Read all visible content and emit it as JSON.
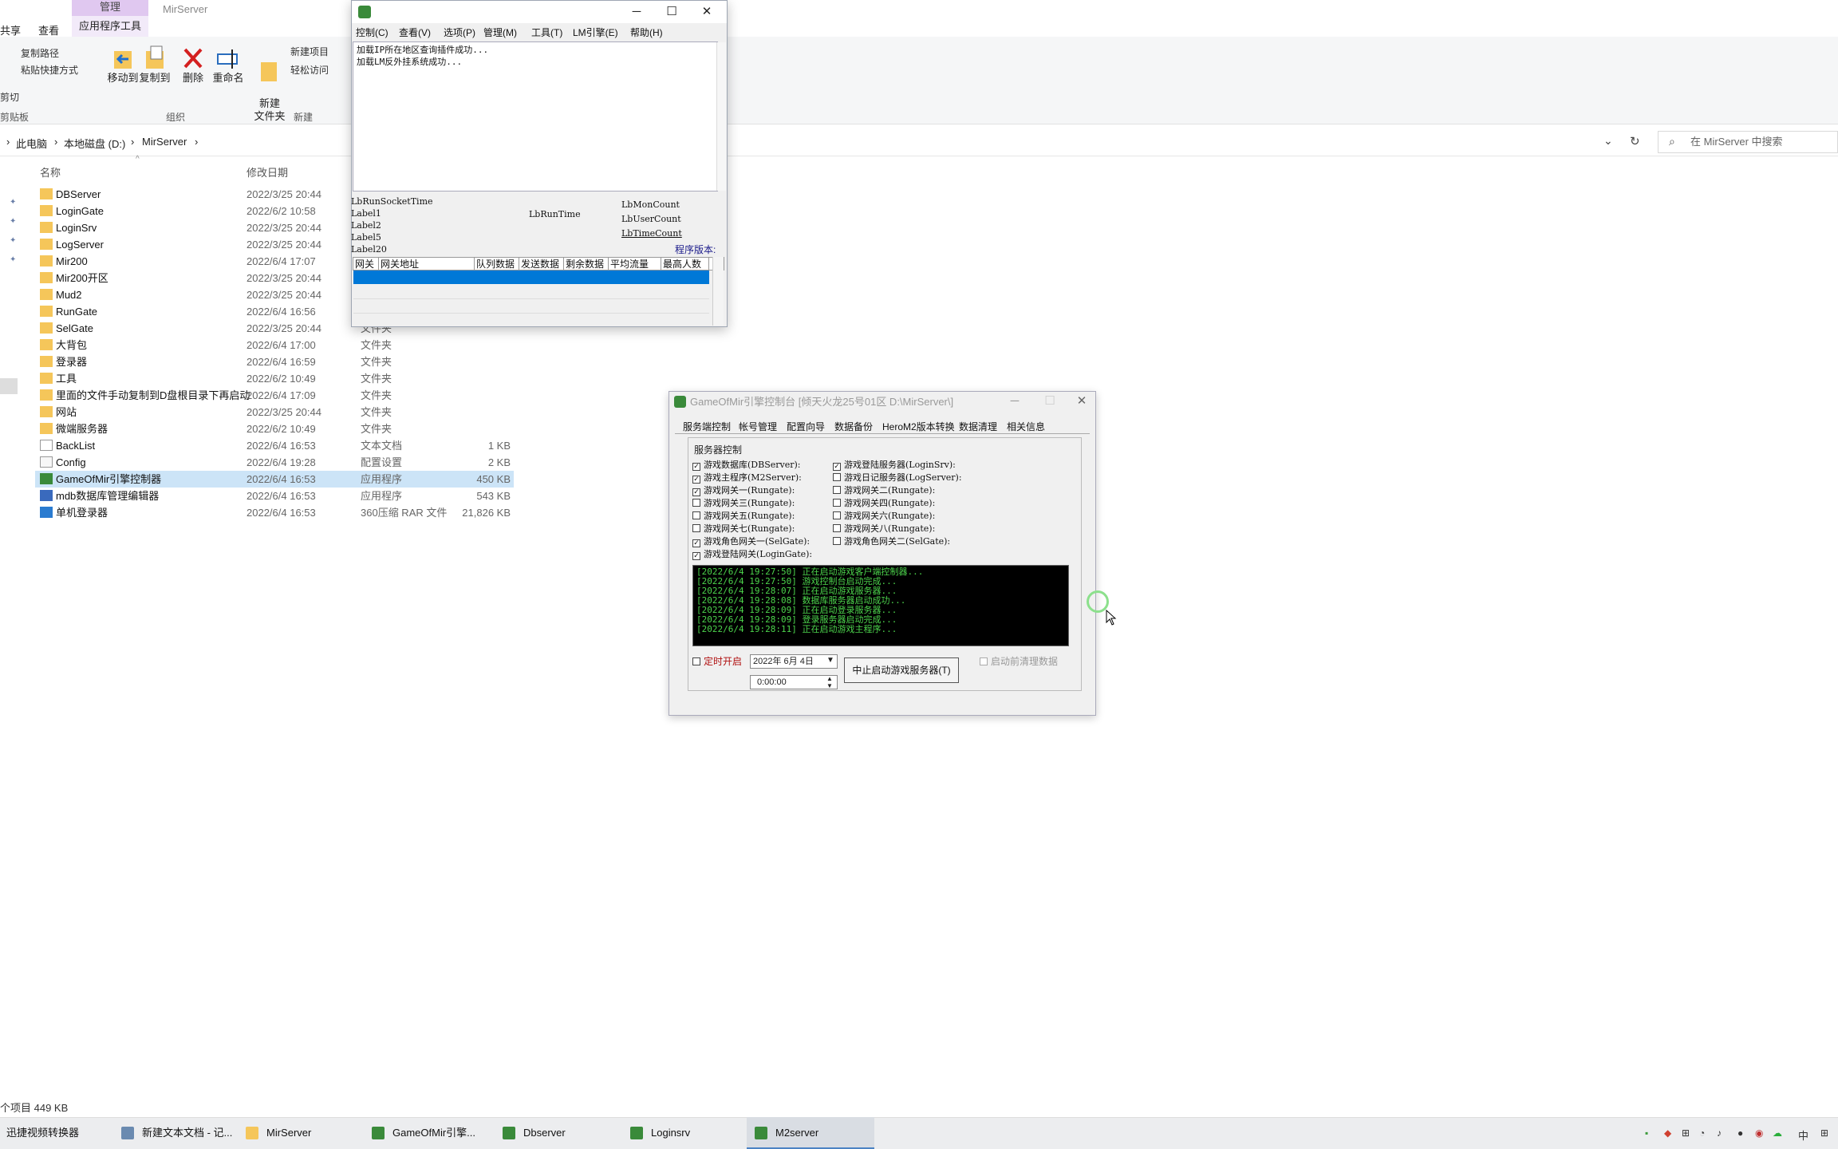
{
  "explorer": {
    "ribbon_tabs": {
      "share": "共享",
      "view": "查看",
      "manage": "管理",
      "app_tools": "应用程序工具"
    },
    "window_title": "MirServer",
    "ribbon": {
      "copy_path": "复制路径",
      "paste_shortcut": "粘贴快捷方式",
      "cut": "剪切",
      "move_to": "移动到",
      "copy_to": "复制到",
      "delete": "删除",
      "rename": "重命名",
      "new_folder": "新建\n文件夹",
      "new_item": "新建项目",
      "easy_access": "轻松访问",
      "group_clipboard": "剪贴板",
      "group_organize": "组织",
      "group_new": "新建"
    },
    "breadcrumbs": [
      "此电脑",
      "本地磁盘 (D:)",
      "MirServer"
    ],
    "search_placeholder": "在 MirServer 中搜索",
    "columns": {
      "name": "名称",
      "date": "修改日期"
    },
    "files": [
      {
        "name": "DBServer",
        "date": "2022/3/25 20:44",
        "type": "",
        "size": "",
        "icon": "folder"
      },
      {
        "name": "LoginGate",
        "date": "2022/6/2 10:58",
        "type": "",
        "size": "",
        "icon": "folder"
      },
      {
        "name": "LoginSrv",
        "date": "2022/3/25 20:44",
        "type": "",
        "size": "",
        "icon": "folder"
      },
      {
        "name": "LogServer",
        "date": "2022/3/25 20:44",
        "type": "",
        "size": "",
        "icon": "folder"
      },
      {
        "name": "Mir200",
        "date": "2022/6/4 17:07",
        "type": "",
        "size": "",
        "icon": "folder"
      },
      {
        "name": "Mir200开区",
        "date": "2022/3/25 20:44",
        "type": "",
        "size": "",
        "icon": "folder"
      },
      {
        "name": "Mud2",
        "date": "2022/3/25 20:44",
        "type": "",
        "size": "",
        "icon": "folder"
      },
      {
        "name": "RunGate",
        "date": "2022/6/4 16:56",
        "type": "",
        "size": "",
        "icon": "folder"
      },
      {
        "name": "SelGate",
        "date": "2022/3/25 20:44",
        "type": "文件夹",
        "size": "",
        "icon": "folder"
      },
      {
        "name": "大背包",
        "date": "2022/6/4 17:00",
        "type": "文件夹",
        "size": "",
        "icon": "folder"
      },
      {
        "name": "登录器",
        "date": "2022/6/4 16:59",
        "type": "文件夹",
        "size": "",
        "icon": "folder"
      },
      {
        "name": "工具",
        "date": "2022/6/2 10:49",
        "type": "文件夹",
        "size": "",
        "icon": "folder"
      },
      {
        "name": "里面的文件手动复制到D盘根目录下再启动",
        "date": "2022/6/4 17:09",
        "type": "文件夹",
        "size": "",
        "icon": "folder"
      },
      {
        "name": "网站",
        "date": "2022/3/25 20:44",
        "type": "文件夹",
        "size": "",
        "icon": "folder"
      },
      {
        "name": "微端服务器",
        "date": "2022/6/2 10:49",
        "type": "文件夹",
        "size": "",
        "icon": "folder"
      },
      {
        "name": "BackList",
        "date": "2022/6/4 16:53",
        "type": "文本文档",
        "size": "1 KB",
        "icon": "doc"
      },
      {
        "name": "Config",
        "date": "2022/6/4 19:28",
        "type": "配置设置",
        "size": "2 KB",
        "icon": "cfg"
      },
      {
        "name": "GameOfMir引擎控制器",
        "date": "2022/6/4 16:53",
        "type": "应用程序",
        "size": "450 KB",
        "icon": "app"
      },
      {
        "name": "mdb数据库管理编辑器",
        "date": "2022/6/4 16:53",
        "type": "应用程序",
        "size": "543 KB",
        "icon": "app2"
      },
      {
        "name": "单机登录器",
        "date": "2022/6/4 16:53",
        "type": "360压缩 RAR 文件",
        "size": "21,826 KB",
        "icon": "rar"
      }
    ],
    "status": "个项目  449 KB"
  },
  "m2": {
    "menu": [
      "控制(C)",
      "查看(V)",
      "选项(P)",
      "管理(M)",
      "工具(T)",
      "LM引擎(E)",
      "帮助(H)"
    ],
    "log": [
      "加载IP所在地区查询插件成功...",
      "加载LM反外挂系统成功..."
    ],
    "labels": {
      "a": "LbRunSocketTime",
      "b": "Label1",
      "c": "Label2",
      "d": "Label5",
      "e": "Label20",
      "f": "LbRunTime",
      "g": "LbMonCount",
      "h": "LbUserCount",
      "i": "LbTimeCount",
      "ver": "程序版本:"
    },
    "grid_cols": [
      "网关",
      "网关地址",
      "队列数据",
      "发送数据",
      "剩余数据",
      "平均流量",
      "最高人数"
    ]
  },
  "gom": {
    "title": "GameOfMir引擎控制台 [倾天火龙25号01区 D:\\MirServer\\]",
    "tabs": [
      "服务端控制",
      "帐号管理",
      "配置向导",
      "数据备份",
      "HeroM2版本转换",
      "数据清理",
      "相关信息"
    ],
    "group": "服务器控制",
    "left": [
      {
        "label": "游戏数据库(DBServer):",
        "checked": true
      },
      {
        "label": "游戏主程序(M2Server):",
        "checked": true
      },
      {
        "label": "游戏网关一(Rungate):",
        "checked": true
      },
      {
        "label": "游戏网关三(Rungate):",
        "checked": false
      },
      {
        "label": "游戏网关五(Rungate):",
        "checked": false
      },
      {
        "label": "游戏网关七(Rungate):",
        "checked": false
      },
      {
        "label": "游戏角色网关一(SelGate):",
        "checked": true
      },
      {
        "label": "游戏登陆网关(LoginGate):",
        "checked": true
      }
    ],
    "right": [
      {
        "label": "游戏登陆服务器(LoginSrv):",
        "checked": true
      },
      {
        "label": "游戏日记服务器(LogServer):",
        "checked": false
      },
      {
        "label": "游戏网关二(Rungate):",
        "checked": false
      },
      {
        "label": "游戏网关四(Rungate):",
        "checked": false
      },
      {
        "label": "游戏网关六(Rungate):",
        "checked": false
      },
      {
        "label": "游戏网关八(Rungate):",
        "checked": false
      },
      {
        "label": "游戏角色网关二(SelGate):",
        "checked": false
      }
    ],
    "log": "[2022/6/4 19:27:50] 正在启动游戏客户端控制器...\n[2022/6/4 19:27:50] 游戏控制台启动完成...\n[2022/6/4 19:28:07] 正在启动游戏服务器...\n[2022/6/4 19:28:08] 数据库服务器启动成功...\n[2022/6/4 19:28:09] 正在启动登录服务器...\n[2022/6/4 19:28:09] 登录服务器启动完成...\n[2022/6/4 19:28:11] 正在启动游戏主程序...",
    "timer": "定时开启",
    "date": "2022年 6月 4日",
    "time": "0:00:00",
    "stop_button": "中止启动游戏服务器(T)",
    "clean_before": "启动前清理数据"
  },
  "taskbar": [
    {
      "label": "迅捷视频转换器"
    },
    {
      "label": "新建文本文档 - 记..."
    },
    {
      "label": "MirServer"
    },
    {
      "label": "GameOfMir引擎..."
    },
    {
      "label": "Dbserver"
    },
    {
      "label": "Loginsrv"
    },
    {
      "label": "M2server"
    }
  ],
  "tray": {
    "ime": "中"
  }
}
